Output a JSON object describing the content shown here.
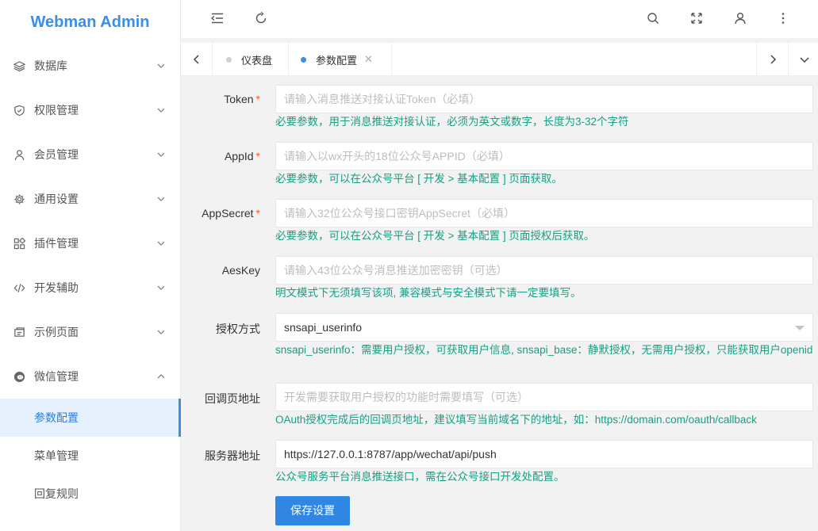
{
  "app": {
    "title": "Webman Admin"
  },
  "sidebar": {
    "items": [
      {
        "label": "数据库",
        "icon": "layers-icon"
      },
      {
        "label": "权限管理",
        "icon": "shield-icon"
      },
      {
        "label": "会员管理",
        "icon": "user-icon"
      },
      {
        "label": "通用设置",
        "icon": "gear-icon"
      },
      {
        "label": "插件管理",
        "icon": "apps-icon"
      },
      {
        "label": "开发辅助",
        "icon": "code-icon"
      },
      {
        "label": "示例页面",
        "icon": "template-icon"
      },
      {
        "label": "微信管理",
        "icon": "wechat-icon",
        "expanded": true
      }
    ],
    "subitems": [
      {
        "label": "参数配置",
        "active": true
      },
      {
        "label": "菜单管理"
      },
      {
        "label": "回复规则"
      }
    ]
  },
  "tabs": [
    {
      "label": "仪表盘",
      "active": false
    },
    {
      "label": "参数配置",
      "active": true,
      "close": "✕"
    }
  ],
  "form": {
    "fields": [
      {
        "label": "Token",
        "required": "*",
        "value": "",
        "placeholder": "请输入消息推送对接认证Token（必填）",
        "hint": "必要参数，用于消息推送对接认证，必须为英文或数字，长度为3-32个字符"
      },
      {
        "label": "AppId",
        "required": "*",
        "value": "",
        "placeholder": "请输入以wx开头的18位公众号APPID（必填）",
        "hint": "必要参数，可以在公众号平台 [ 开发 > 基本配置 ] 页面获取。"
      },
      {
        "label": "AppSecret",
        "required": "*",
        "value": "",
        "placeholder": "请输入32位公众号接口密钥AppSecret（必填）",
        "hint": "必要参数，可以在公众号平台 [ 开发 > 基本配置 ] 页面授权后获取。"
      },
      {
        "label": "AesKey",
        "required": "",
        "value": "",
        "placeholder": "请输入43位公众号消息推送加密密钥（可选）",
        "hint": "明文模式下无须填写该项, 兼容模式与安全模式下请一定要填写。"
      },
      {
        "label": "授权方式",
        "required": "",
        "value": "snsapi_userinfo",
        "placeholder": "",
        "hint": "snsapi_userinfo：需要用户授权，可获取用户信息, snsapi_base：静默授权，无需用户授权，只能获取用户openid"
      },
      {
        "label": "回调页地址",
        "required": "",
        "value": "",
        "placeholder": "开发需要获取用户授权的功能时需要填写（可选）",
        "hint": "OAuth授权完成后的回调页地址，建议填写当前域名下的地址，如：https://domain.com/oauth/callback"
      },
      {
        "label": "服务器地址",
        "required": "",
        "value": "https://127.0.0.1:8787/app/wechat/api/push",
        "placeholder": "",
        "hint": "公众号服务平台消息推送接口，需在公众号接口开发处配置。"
      }
    ],
    "submit_label": "保存设置"
  },
  "colors": {
    "accent": "#3a8ee6",
    "hint": "#16a085",
    "required": "#ff5722"
  }
}
